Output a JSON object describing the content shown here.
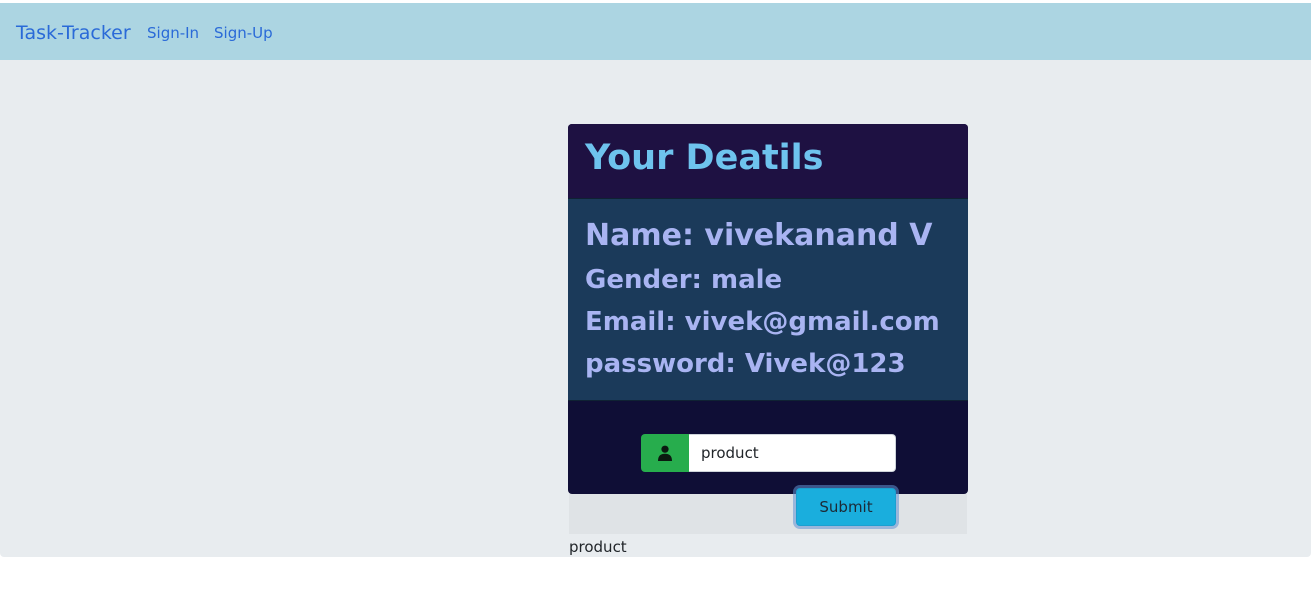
{
  "navbar": {
    "brand": "Task-Tracker",
    "links": [
      "Sign-In",
      "Sign-Up"
    ]
  },
  "card": {
    "title": "Your Deatils",
    "details": {
      "name": "Name: vivekanand V",
      "gender": "Gender: male",
      "email": "Email: vivek@gmail.com",
      "password": "password: Vivek@123"
    },
    "input": {
      "icon": "user-icon",
      "value": "product"
    },
    "submit_label": "Submit"
  },
  "output_text": "product",
  "colors": {
    "navbar_bg": "#acd5e2",
    "link": "#2a6ad8",
    "page_bg": "#e8ecef",
    "card_bg": "#0f0e36",
    "card_header_bg": "#1e1142",
    "card_title": "#6ec3ee",
    "card_body_bg": "#1b3a5a",
    "detail_text": "#a9b4f2",
    "icon_box": "#27ad4d",
    "submit_bg": "#1aaedd"
  }
}
